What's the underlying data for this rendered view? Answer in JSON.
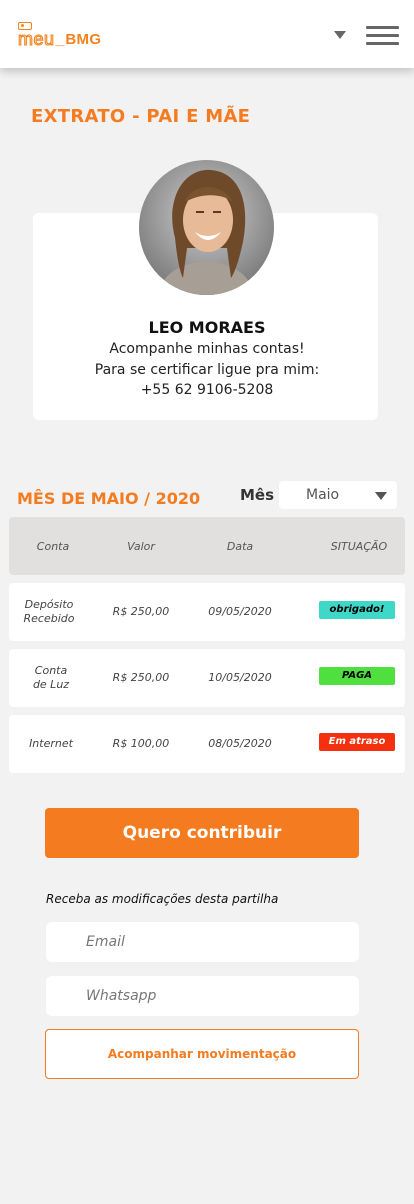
{
  "header": {
    "logo_prefix": "meu",
    "logo_brand": "BMG",
    "icons": {
      "dropdown": "caret-down-icon",
      "menu": "hamburger-menu-icon"
    }
  },
  "page": {
    "title": "EXTRATO - PAI E MÃE"
  },
  "profile": {
    "name": "LEO MORAES",
    "line1": "Acompanhe minhas contas!",
    "line2": "Para se certificar ligue pra mim:",
    "phone": "+55 62 9106-5208"
  },
  "statement": {
    "title": "MÊS DE MAIO / 2020",
    "month_label": "Mês",
    "month_value": "Maio",
    "columns": [
      "Conta",
      "Valor",
      "Data",
      "SITUAÇÃO"
    ],
    "rows": [
      {
        "account": [
          "Depósito",
          "Recebido"
        ],
        "value": "R$ 250,00",
        "date": "09/05/2020",
        "status": "obrigado!",
        "status_color": "#3fd8c8"
      },
      {
        "account": [
          "Conta",
          "de Luz"
        ],
        "value": "R$ 250,00",
        "date": "10/05/2020",
        "status": "PAGA",
        "status_color": "#4fe03f"
      },
      {
        "account": [
          "Internet"
        ],
        "value": "R$ 100,00",
        "date": "08/05/2020",
        "status": "Em atraso",
        "status_color": "#f5300e"
      }
    ]
  },
  "actions": {
    "contribute": "Quero contribuir",
    "subscribe_text": "Receba as modificações desta partilha",
    "email_placeholder": "Email",
    "whatsapp_placeholder": "Whatsapp",
    "follow": "Acompanhar movimentação"
  },
  "colors": {
    "accent": "#f47b20",
    "background": "#f2f2f2"
  }
}
